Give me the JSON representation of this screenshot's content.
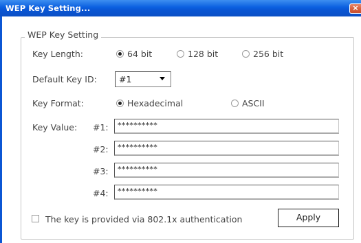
{
  "window": {
    "title": "WEP Key Setting...",
    "close_glyph": "×",
    "title_bar_color": "#0a5fe0",
    "close_button_color": "#d9623f"
  },
  "group": {
    "legend": "WEP Key Setting"
  },
  "key_length": {
    "label": "Key Length:",
    "options": [
      "64 bit",
      "128 bit",
      "256 bit"
    ],
    "selected": "64 bit"
  },
  "default_key_id": {
    "label": "Default Key ID:",
    "value": "#1"
  },
  "key_format": {
    "label": "Key Format:",
    "options": [
      "Hexadecimal",
      "ASCII"
    ],
    "selected": "Hexadecimal"
  },
  "key_value": {
    "label": "Key Value:",
    "keys": [
      {
        "id": "#1:",
        "value": "**********"
      },
      {
        "id": "#2:",
        "value": "**********"
      },
      {
        "id": "#3:",
        "value": "**********"
      },
      {
        "id": "#4:",
        "value": "**********"
      }
    ]
  },
  "auth": {
    "label": "The key is provided via 802.1x authentication",
    "checked": false
  },
  "apply_label": "Apply"
}
